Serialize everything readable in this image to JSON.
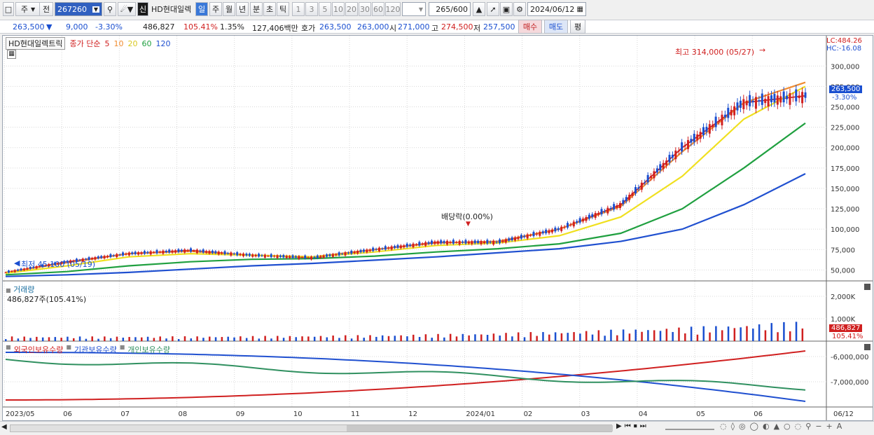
{
  "toolbar": {
    "period_label": "주",
    "prev_label": "전",
    "stock_code": "267260",
    "market_badge": "신",
    "stock_name": "HD현대일렉",
    "period_buttons": [
      "일",
      "주",
      "월",
      "년",
      "분",
      "초",
      "틱"
    ],
    "tick_buttons": [
      "1",
      "3",
      "5",
      "10",
      "20",
      "30",
      "60",
      "120"
    ],
    "count_current": "265",
    "count_total": "/600",
    "date": "2024/06/12"
  },
  "quote": {
    "price": "263,500",
    "change": "9,000",
    "change_pct": "-3.30%",
    "volume": "486,827",
    "volume_pct": "105.41%",
    "turnover_pct": "1.35%",
    "amount": "127,406백만",
    "bid_label": "호가",
    "bid": "263,500",
    "ask": "263,000",
    "open_label": "시",
    "open": "271,000",
    "high_label": "고",
    "high": "274,500",
    "low_label": "저",
    "low": "257,500",
    "buy_label": "매수",
    "sell_label": "매도",
    "eval_label": "평"
  },
  "price_panel": {
    "legend_name": "HD현대일렉트릭",
    "legend_ma_label": "종가 단순",
    "ma_periods": [
      "5",
      "10",
      "20",
      "60",
      "120"
    ],
    "ma_colors": [
      "#e02020",
      "#f08c30",
      "#f0e020",
      "#20a040",
      "#2050d0"
    ],
    "lc_label": "LC:484.26",
    "hc_label": "HC:-16.08",
    "high_annotation": "최고 314,000 (05/27)",
    "low_annotation": "최저 45,100 (05/19)",
    "dividend_annotation": "배당락(0.00%)",
    "current_price_tag": "263,500",
    "current_pct_tag": "-3.30%",
    "y_ticks": [
      "300,000",
      "275,000",
      "250,000",
      "225,000",
      "200,000",
      "175,000",
      "150,000",
      "125,000",
      "100,000",
      "75,000",
      "50,000"
    ]
  },
  "volume_panel": {
    "title": "거래량",
    "value_label": "486,827주(105.41%)",
    "y_ticks": [
      "2,000K",
      "1,000K"
    ],
    "current_tag": "486,827",
    "current_pct_tag": "105.41%"
  },
  "holdings_panel": {
    "legend": [
      "외국인보유수량",
      "기관보유수량",
      "개인보유수량"
    ],
    "legend_colors": [
      "#d02020",
      "#2050d0",
      "#309060"
    ],
    "y_ticks": [
      "-6,000,000",
      "-7,000,000"
    ]
  },
  "x_axis": [
    "2023/05",
    "06",
    "07",
    "08",
    "09",
    "10",
    "11",
    "12",
    "2024/01",
    "02",
    "03",
    "04",
    "05",
    "06",
    "06/12"
  ],
  "chart_data": {
    "type": "line",
    "title": "HD현대일렉트릭",
    "period": "weekly",
    "x": [
      "2023/05",
      "2023/06",
      "2023/07",
      "2023/08",
      "2023/09",
      "2023/10",
      "2023/11",
      "2023/12",
      "2024/01",
      "2024/02",
      "2024/03",
      "2024/04",
      "2024/05",
      "2024/06"
    ],
    "series": [
      {
        "name": "종가",
        "values": [
          47000,
          60000,
          70000,
          74000,
          68000,
          65000,
          75000,
          84000,
          84000,
          100000,
          130000,
          200000,
          255000,
          263500
        ]
      },
      {
        "name": "5",
        "values": [
          47000,
          59000,
          70000,
          73000,
          68000,
          66000,
          75000,
          83000,
          85000,
          100000,
          128000,
          195000,
          255000,
          280000
        ]
      },
      {
        "name": "20",
        "values": [
          46000,
          55000,
          66000,
          70000,
          68000,
          66000,
          72000,
          80000,
          83000,
          92000,
          115000,
          165000,
          235000,
          275000
        ]
      },
      {
        "name": "60",
        "values": [
          44000,
          48000,
          55000,
          60000,
          63000,
          64000,
          67000,
          72000,
          76000,
          82000,
          95000,
          125000,
          175000,
          230000
        ]
      },
      {
        "name": "120",
        "values": [
          42000,
          44000,
          47000,
          51000,
          55000,
          58000,
          62000,
          66000,
          71000,
          76000,
          85000,
          100000,
          130000,
          168000
        ]
      }
    ],
    "ylim": [
      40000,
      320000
    ],
    "annotations": [
      "최고 314,000 (05/27)",
      "최저 45,100 (05/19)",
      "배당락(0.00%)"
    ]
  }
}
